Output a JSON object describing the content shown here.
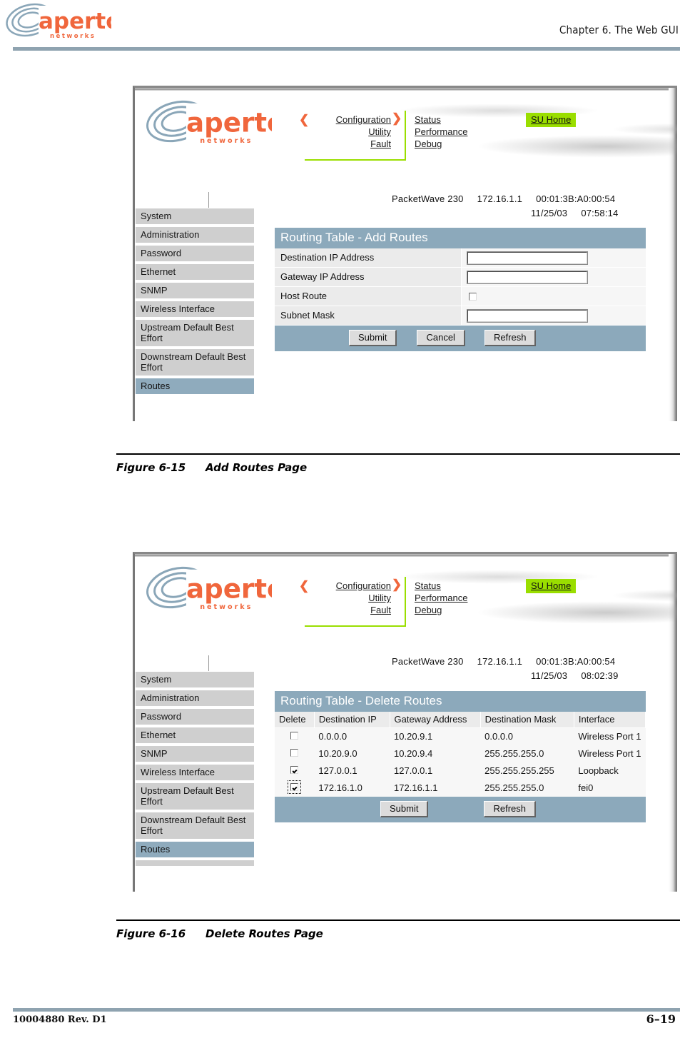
{
  "document": {
    "brand": "aperto networks",
    "chapter_header": "Chapter 6.  The Web GUI",
    "footer_doc_number": "10004880 Rev. D1",
    "footer_page": "6–19"
  },
  "figures": [
    {
      "number": "Figure 6-15",
      "title": "Add Routes Page"
    },
    {
      "number": "Figure 6-16",
      "title": "Delete Routes Page"
    }
  ],
  "gui": {
    "nav_left": [
      "Configuration",
      "Utility",
      "Fault"
    ],
    "nav_right": [
      "Status",
      "Performance",
      "Debug"
    ],
    "su_home": "SU Home",
    "accent_green": "#9ade00",
    "accent_orange": "#f0663c",
    "panel_blue": "#8ca9bb",
    "sidebar_items": [
      "System",
      "Administration",
      "Password",
      "Ethernet",
      "SNMP",
      "Wireless Interface",
      "Upstream Default Best Effort",
      "Downstream Default Best Effort",
      "Routes"
    ],
    "sidebar_active": "Routes"
  },
  "screen_add": {
    "device": {
      "model": "PacketWave 230",
      "ip": "172.16.1.1",
      "mac": "00:01:3B:A0:00:54",
      "date": "11/25/03",
      "time": "07:58:14"
    },
    "panel_title": "Routing Table - Add Routes",
    "fields": [
      {
        "label": "Destination IP Address",
        "type": "text",
        "value": ""
      },
      {
        "label": "Gateway IP Address",
        "type": "text",
        "value": ""
      },
      {
        "label": "Host Route",
        "type": "checkbox",
        "checked": false
      },
      {
        "label": "Subnet Mask",
        "type": "text",
        "value": ""
      }
    ],
    "buttons": [
      "Submit",
      "Cancel",
      "Refresh"
    ]
  },
  "screen_delete": {
    "device": {
      "model": "PacketWave 230",
      "ip": "172.16.1.1",
      "mac": "00:01:3B:A0:00:54",
      "date": "11/25/03",
      "time": "08:02:39"
    },
    "panel_title": "Routing Table - Delete Routes",
    "columns": [
      "Delete",
      "Destination IP",
      "Gateway Address",
      "Destination Mask",
      "Interface"
    ],
    "rows": [
      {
        "delete": false,
        "focus": false,
        "destination_ip": "0.0.0.0",
        "gateway_address": "10.20.9.1",
        "destination_mask": "0.0.0.0",
        "interface": "Wireless Port 1"
      },
      {
        "delete": false,
        "focus": false,
        "destination_ip": "10.20.9.0",
        "gateway_address": "10.20.9.4",
        "destination_mask": "255.255.255.0",
        "interface": "Wireless Port 1"
      },
      {
        "delete": true,
        "focus": false,
        "destination_ip": "127.0.0.1",
        "gateway_address": "127.0.0.1",
        "destination_mask": "255.255.255.255",
        "interface": "Loopback"
      },
      {
        "delete": true,
        "focus": true,
        "destination_ip": "172.16.1.0",
        "gateway_address": "172.16.1.1",
        "destination_mask": "255.255.255.0",
        "interface": "fei0"
      }
    ],
    "buttons": [
      "Submit",
      "Refresh"
    ],
    "sidebar_partial_item": ""
  }
}
